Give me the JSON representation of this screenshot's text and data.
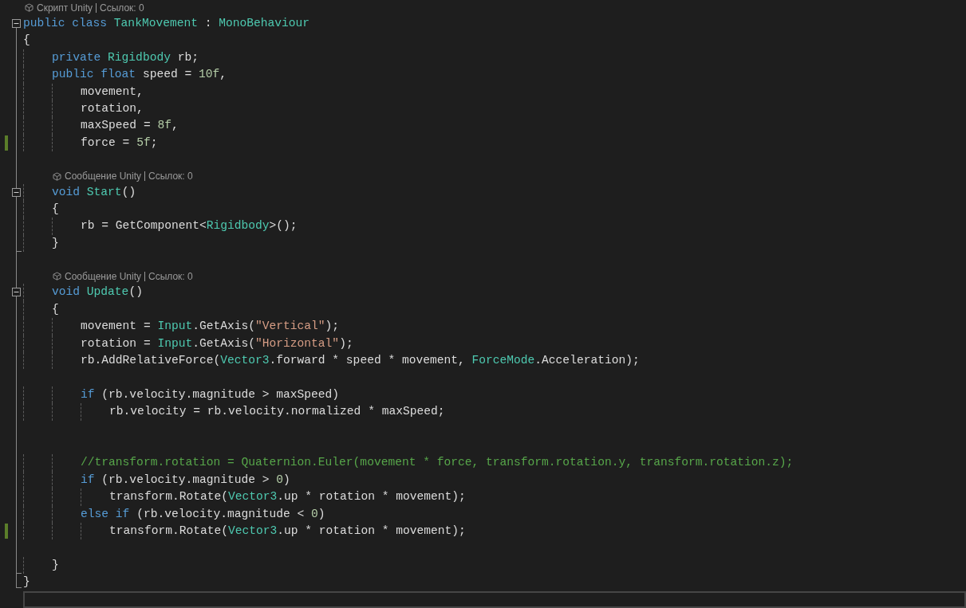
{
  "editor": {
    "lines": [
      {
        "kind": "lens",
        "parts": [
          "Скрипт Unity",
          "Ссылок: 0"
        ]
      },
      {
        "kind": "code",
        "fold_open": true,
        "fold_end": false,
        "changed": false,
        "tokens": [
          {
            "kind": "keyword",
            "text": "public "
          },
          {
            "kind": "keyword",
            "text": "class "
          },
          {
            "kind": "type",
            "text": "TankMovement"
          },
          {
            "kind": "plain",
            "text": " : "
          },
          {
            "kind": "type",
            "text": "MonoBehaviour"
          }
        ]
      },
      {
        "kind": "code",
        "fold_open": false,
        "fold_end": false,
        "changed": false,
        "tokens": [
          {
            "kind": "plain",
            "text": "{"
          }
        ]
      },
      {
        "kind": "code",
        "fold_open": false,
        "fold_end": false,
        "changed": false,
        "tokens": [
          {
            "kind": "keyword",
            "text": "    private "
          },
          {
            "kind": "type",
            "text": "Rigidbody"
          },
          {
            "kind": "plain",
            "text": " rb;"
          }
        ]
      },
      {
        "kind": "code",
        "fold_open": false,
        "fold_end": false,
        "changed": false,
        "tokens": [
          {
            "kind": "keyword",
            "text": "    public "
          },
          {
            "kind": "keyword",
            "text": "float "
          },
          {
            "kind": "plain",
            "text": "speed = "
          },
          {
            "kind": "number",
            "text": "10f"
          },
          {
            "kind": "plain",
            "text": ","
          }
        ]
      },
      {
        "kind": "code",
        "fold_open": false,
        "fold_end": false,
        "changed": false,
        "tokens": [
          {
            "kind": "plain",
            "text": "        movement,"
          }
        ]
      },
      {
        "kind": "code",
        "fold_open": false,
        "fold_end": false,
        "changed": false,
        "tokens": [
          {
            "kind": "plain",
            "text": "        rotation,"
          }
        ]
      },
      {
        "kind": "code",
        "fold_open": false,
        "fold_end": false,
        "changed": false,
        "tokens": [
          {
            "kind": "plain",
            "text": "        maxSpeed = "
          },
          {
            "kind": "number",
            "text": "8f"
          },
          {
            "kind": "plain",
            "text": ","
          }
        ]
      },
      {
        "kind": "code",
        "fold_open": false,
        "fold_end": false,
        "changed": true,
        "tokens": [
          {
            "kind": "plain",
            "text": "        force = "
          },
          {
            "kind": "number",
            "text": "5f"
          },
          {
            "kind": "plain",
            "text": ";"
          }
        ]
      },
      {
        "kind": "blank"
      },
      {
        "kind": "lens",
        "parts": [
          "Сообщение Unity",
          "Ссылок: 0"
        ]
      },
      {
        "kind": "code",
        "fold_open": true,
        "fold_end": false,
        "changed": false,
        "tokens": [
          {
            "kind": "keyword",
            "text": "    void "
          },
          {
            "kind": "type",
            "text": "Start"
          },
          {
            "kind": "plain",
            "text": "()"
          }
        ]
      },
      {
        "kind": "code",
        "fold_open": false,
        "fold_end": false,
        "changed": false,
        "tokens": [
          {
            "kind": "plain",
            "text": "    {"
          }
        ]
      },
      {
        "kind": "code",
        "fold_open": false,
        "fold_end": false,
        "changed": false,
        "tokens": [
          {
            "kind": "plain",
            "text": "        rb = GetComponent<"
          },
          {
            "kind": "type",
            "text": "Rigidbody"
          },
          {
            "kind": "plain",
            "text": ">();"
          }
        ]
      },
      {
        "kind": "code",
        "fold_open": false,
        "fold_end": true,
        "changed": false,
        "tokens": [
          {
            "kind": "plain",
            "text": "    }"
          }
        ]
      },
      {
        "kind": "blank"
      },
      {
        "kind": "lens",
        "parts": [
          "Сообщение Unity",
          "Ссылок: 0"
        ]
      },
      {
        "kind": "code",
        "fold_open": true,
        "fold_end": false,
        "changed": false,
        "tokens": [
          {
            "kind": "keyword",
            "text": "    void "
          },
          {
            "kind": "type",
            "text": "Update"
          },
          {
            "kind": "plain",
            "text": "()"
          }
        ]
      },
      {
        "kind": "code",
        "fold_open": false,
        "fold_end": false,
        "changed": false,
        "tokens": [
          {
            "kind": "plain",
            "text": "    {"
          }
        ]
      },
      {
        "kind": "code",
        "fold_open": false,
        "fold_end": false,
        "changed": false,
        "tokens": [
          {
            "kind": "plain",
            "text": "        movement = "
          },
          {
            "kind": "type",
            "text": "Input"
          },
          {
            "kind": "plain",
            "text": ".GetAxis("
          },
          {
            "kind": "string",
            "text": "\"Vertical\""
          },
          {
            "kind": "plain",
            "text": ");"
          }
        ]
      },
      {
        "kind": "code",
        "fold_open": false,
        "fold_end": false,
        "changed": false,
        "tokens": [
          {
            "kind": "plain",
            "text": "        rotation = "
          },
          {
            "kind": "type",
            "text": "Input"
          },
          {
            "kind": "plain",
            "text": ".GetAxis("
          },
          {
            "kind": "string",
            "text": "\"Horizontal\""
          },
          {
            "kind": "plain",
            "text": ");"
          }
        ]
      },
      {
        "kind": "code",
        "fold_open": false,
        "fold_end": false,
        "changed": false,
        "tokens": [
          {
            "kind": "plain",
            "text": "        rb.AddRelativeForce("
          },
          {
            "kind": "type",
            "text": "Vector3"
          },
          {
            "kind": "plain",
            "text": ".forward * speed * movement, "
          },
          {
            "kind": "type",
            "text": "ForceMode"
          },
          {
            "kind": "plain",
            "text": ".Acceleration);"
          }
        ]
      },
      {
        "kind": "blank"
      },
      {
        "kind": "code",
        "fold_open": false,
        "fold_end": false,
        "changed": false,
        "tokens": [
          {
            "kind": "keyword",
            "text": "        if "
          },
          {
            "kind": "plain",
            "text": "(rb.velocity.magnitude > maxSpeed)"
          }
        ]
      },
      {
        "kind": "code",
        "fold_open": false,
        "fold_end": false,
        "changed": false,
        "tokens": [
          {
            "kind": "plain",
            "text": "            rb.velocity = rb.velocity.normalized * maxSpeed;"
          }
        ]
      },
      {
        "kind": "blank"
      },
      {
        "kind": "blank"
      },
      {
        "kind": "code",
        "fold_open": false,
        "fold_end": false,
        "changed": false,
        "tokens": [
          {
            "kind": "comment",
            "text": "        //transform.rotation = Quaternion.Euler(movement * force, transform.rotation.y, transform.rotation.z);"
          }
        ]
      },
      {
        "kind": "code",
        "fold_open": false,
        "fold_end": false,
        "changed": false,
        "tokens": [
          {
            "kind": "keyword",
            "text": "        if "
          },
          {
            "kind": "plain",
            "text": "(rb.velocity.magnitude > "
          },
          {
            "kind": "number",
            "text": "0"
          },
          {
            "kind": "plain",
            "text": ")"
          }
        ]
      },
      {
        "kind": "code",
        "fold_open": false,
        "fold_end": false,
        "changed": false,
        "tokens": [
          {
            "kind": "plain",
            "text": "            transform.Rotate("
          },
          {
            "kind": "type",
            "text": "Vector3"
          },
          {
            "kind": "plain",
            "text": ".up * rotation * movement);"
          }
        ]
      },
      {
        "kind": "code",
        "fold_open": false,
        "fold_end": false,
        "changed": false,
        "tokens": [
          {
            "kind": "keyword",
            "text": "        else "
          },
          {
            "kind": "keyword",
            "text": "if "
          },
          {
            "kind": "plain",
            "text": "(rb.velocity.magnitude < "
          },
          {
            "kind": "number",
            "text": "0"
          },
          {
            "kind": "plain",
            "text": ")"
          }
        ]
      },
      {
        "kind": "code",
        "fold_open": false,
        "fold_end": false,
        "changed": true,
        "tokens": [
          {
            "kind": "plain",
            "text": "            transform.Rotate("
          },
          {
            "kind": "type",
            "text": "Vector3"
          },
          {
            "kind": "plain",
            "text": ".up * rotation * movement);"
          }
        ]
      },
      {
        "kind": "blank"
      },
      {
        "kind": "code",
        "fold_open": false,
        "fold_end": true,
        "changed": false,
        "tokens": [
          {
            "kind": "plain",
            "text": "    }"
          }
        ]
      },
      {
        "kind": "code",
        "fold_open": false,
        "fold_end": true,
        "changed": false,
        "tokens": [
          {
            "kind": "plain",
            "text": "}"
          }
        ]
      },
      {
        "kind": "cursor"
      }
    ]
  }
}
